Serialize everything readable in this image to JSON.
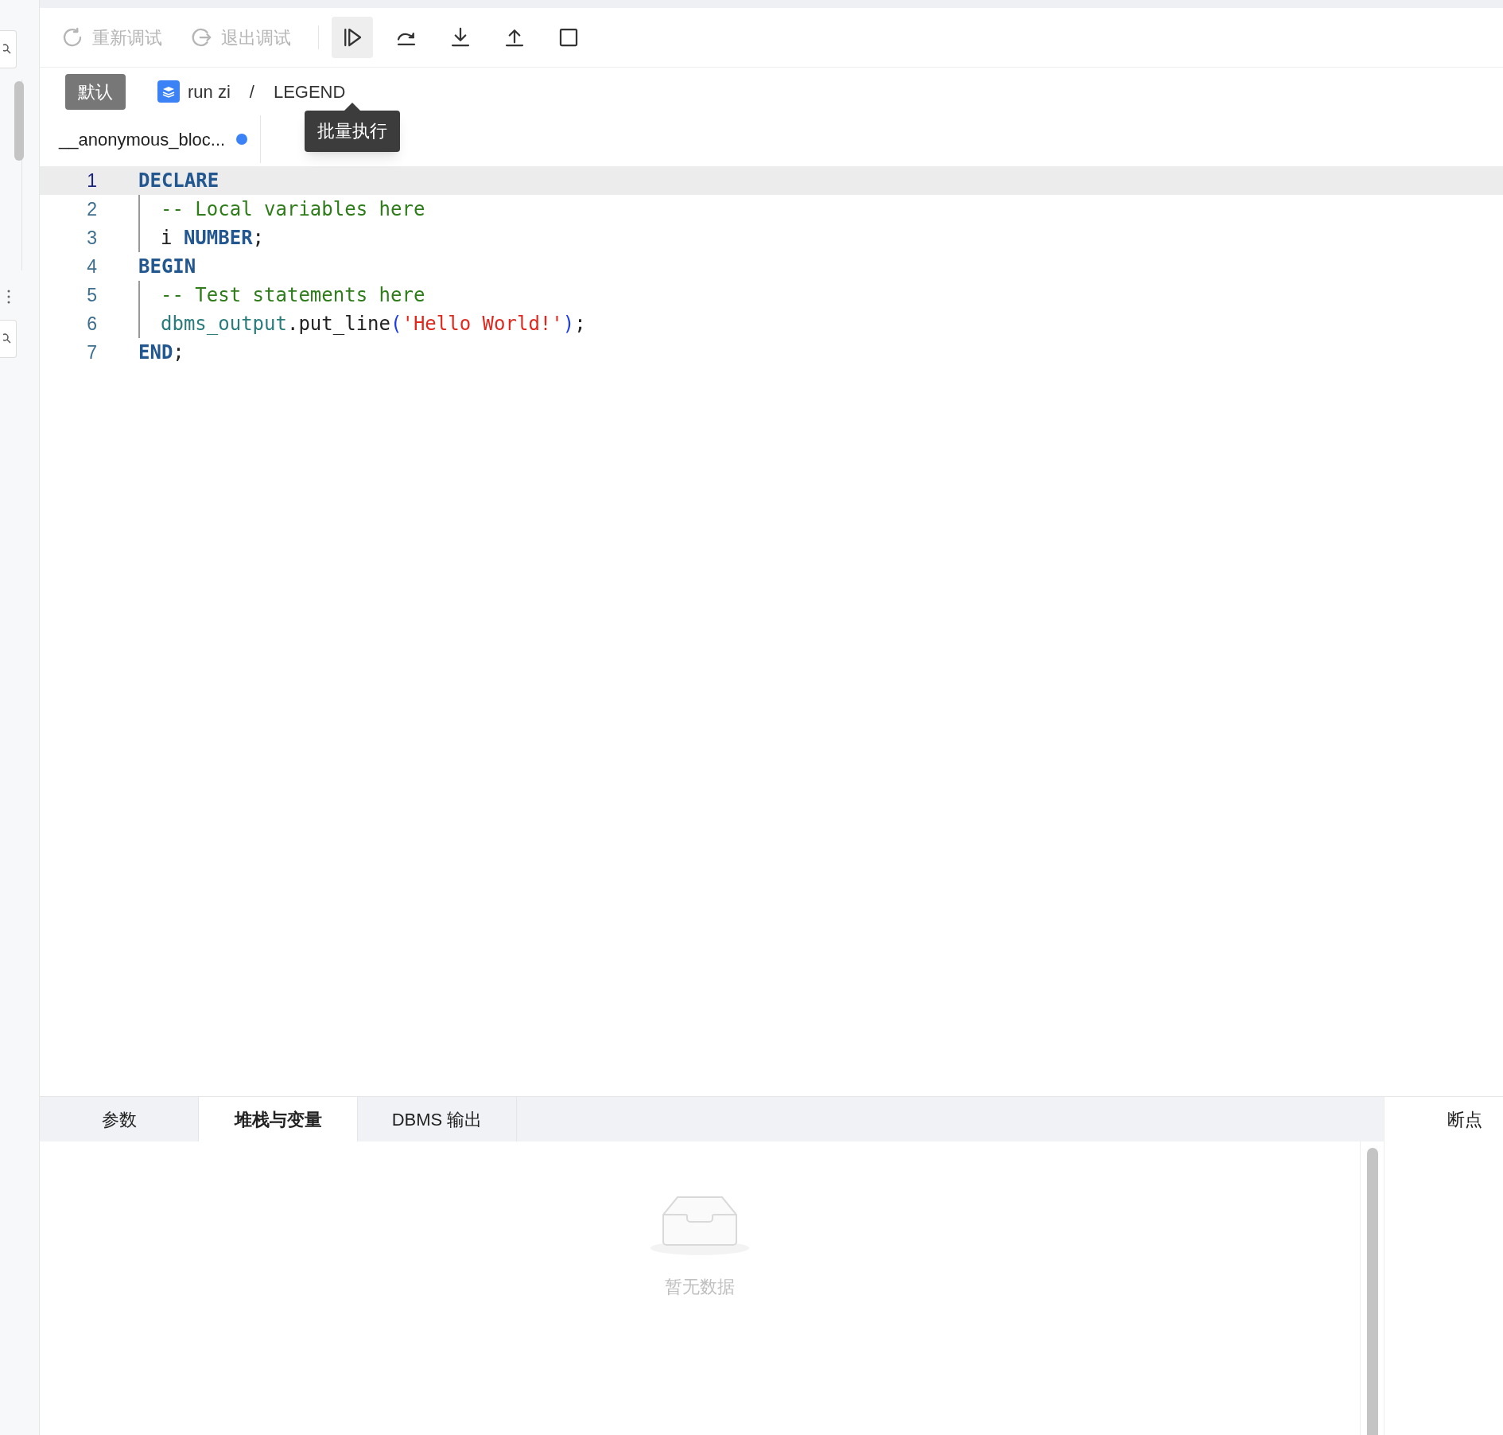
{
  "toolbar": {
    "actions": [
      {
        "kind": "restart",
        "label": "重新调试",
        "disabled": true
      },
      {
        "kind": "exit",
        "label": "退出调试",
        "disabled": true
      }
    ],
    "icon_buttons": [
      {
        "kind": "run",
        "hovered": true
      },
      {
        "kind": "step_over",
        "hovered": false
      },
      {
        "kind": "step_into",
        "hovered": false
      },
      {
        "kind": "step_out",
        "hovered": false
      },
      {
        "kind": "stop",
        "hovered": false
      }
    ],
    "tooltip": "批量执行"
  },
  "breadcrumb": {
    "tag": "默认",
    "database": "run zi",
    "separator": "/",
    "object": "LEGEND"
  },
  "file_tab": {
    "label": "__anonymous_bloc...",
    "modified": true
  },
  "editor": {
    "lines": [
      {
        "number": "1",
        "current": true,
        "tokens": [
          {
            "kind": "keyword",
            "text": "DECLARE"
          }
        ],
        "children": [
          {
            "number": "2",
            "current": false,
            "tokens": [
              {
                "kind": "comment",
                "text": "-- Local variables here"
              }
            ]
          },
          {
            "number": "3",
            "current": false,
            "tokens": [
              {
                "kind": "plain",
                "text": "i "
              },
              {
                "kind": "keyword",
                "text": "NUMBER"
              },
              {
                "kind": "plain",
                "text": ";"
              }
            ]
          }
        ]
      },
      {
        "number": "4",
        "current": false,
        "tokens": [
          {
            "kind": "keyword",
            "text": "BEGIN"
          }
        ],
        "children": [
          {
            "number": "5",
            "current": false,
            "tokens": [
              {
                "kind": "comment",
                "text": "-- Test statements here"
              }
            ]
          },
          {
            "number": "6",
            "current": false,
            "tokens": [
              {
                "kind": "ident",
                "text": "dbms_output"
              },
              {
                "kind": "plain",
                "text": ".put_line"
              },
              {
                "kind": "paren",
                "text": "("
              },
              {
                "kind": "string",
                "text": "'Hello World!'"
              },
              {
                "kind": "paren",
                "text": ")"
              },
              {
                "kind": "plain",
                "text": ";"
              }
            ]
          }
        ]
      },
      {
        "number": "7",
        "current": false,
        "tokens": [
          {
            "kind": "keyword",
            "text": "END"
          },
          {
            "kind": "plain",
            "text": ";"
          }
        ]
      }
    ]
  },
  "bottom_panel": {
    "tabs": [
      {
        "label": "参数",
        "selected": false
      },
      {
        "label": "堆栈与变量",
        "selected": true
      },
      {
        "label": "DBMS 输出",
        "selected": false
      }
    ],
    "side_tab": "断点",
    "empty_text": "暂无数据"
  }
}
